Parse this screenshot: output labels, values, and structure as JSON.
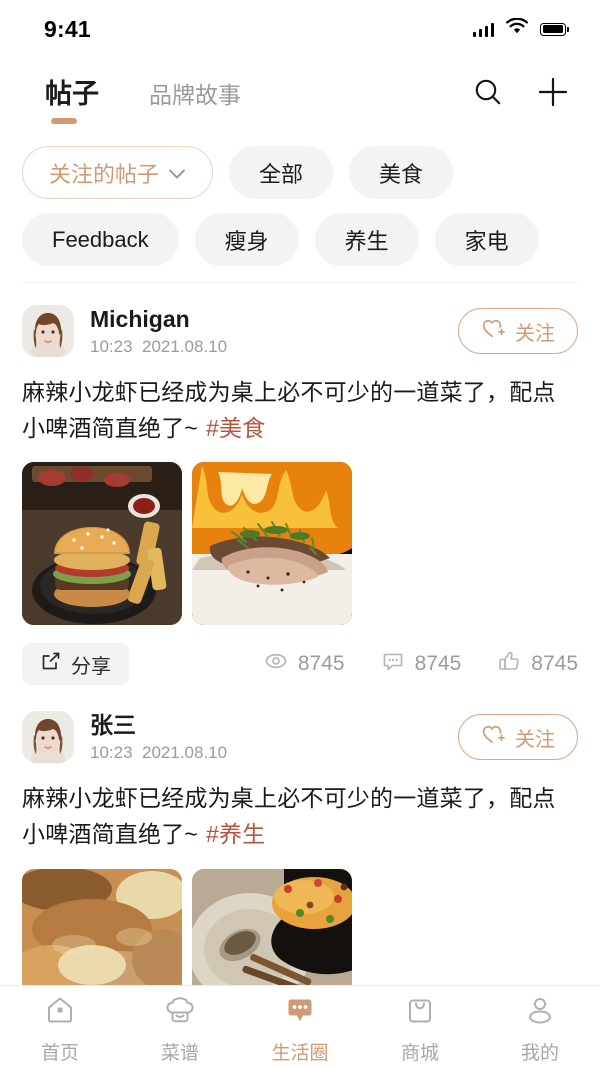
{
  "status_bar": {
    "time": "9:41",
    "signal_icon": "cellular-signal-icon",
    "wifi_icon": "wifi-icon",
    "battery_icon": "battery-full-icon"
  },
  "header": {
    "tabs": [
      {
        "label": "帖子",
        "active": true
      },
      {
        "label": "品牌故事",
        "active": false
      }
    ],
    "search_icon": "search-icon",
    "add_icon": "plus-icon"
  },
  "filters": {
    "selector": {
      "label": "关注的帖子",
      "chevron_icon": "chevron-down-icon"
    },
    "row1": [
      "全部",
      "美食"
    ],
    "row2": [
      "Feedback",
      "瘦身",
      "养生",
      "家电"
    ]
  },
  "posts": [
    {
      "author": "Michigan",
      "time": "10:23",
      "date": "2021.08.10",
      "follow_label": "关注",
      "follow_icon": "heart-plus-icon",
      "text": "麻辣小龙虾已经成为桌上必不可少的一道菜了，配点小啤酒简直绝了~",
      "hashtag": "#美食",
      "share_label": "分享",
      "share_icon": "share-icon",
      "stats": [
        {
          "icon": "eye-icon",
          "value": "8745"
        },
        {
          "icon": "comment-icon",
          "value": "8745"
        },
        {
          "icon": "thumbs-up-icon",
          "value": "8745"
        }
      ],
      "photos": [
        "burger-with-fries-photo",
        "grilled-steak-with-flames-photo"
      ]
    },
    {
      "author": "张三",
      "time": "10:23",
      "date": "2021.08.10",
      "follow_label": "关注",
      "follow_icon": "heart-plus-icon",
      "text": "麻辣小龙虾已经成为桌上必不可少的一道菜了，配点小啤酒简直绝了~",
      "hashtag": "#养生",
      "photos": [
        "fried-food-photo",
        "fried-rice-photo"
      ]
    }
  ],
  "bottom_nav": [
    {
      "label": "首页",
      "icon": "home-icon",
      "active": false
    },
    {
      "label": "菜谱",
      "icon": "chef-hat-icon",
      "active": false
    },
    {
      "label": "生活圈",
      "icon": "chat-bubble-icon",
      "active": true
    },
    {
      "label": "商城",
      "icon": "shopping-bag-icon",
      "active": false
    },
    {
      "label": "我的",
      "icon": "person-icon",
      "active": false
    }
  ],
  "colors": {
    "accent": "#cf9b76",
    "hashtag": "#b5553f",
    "chip_bg": "#f2f3f5",
    "muted_text": "#9b9b9b"
  }
}
